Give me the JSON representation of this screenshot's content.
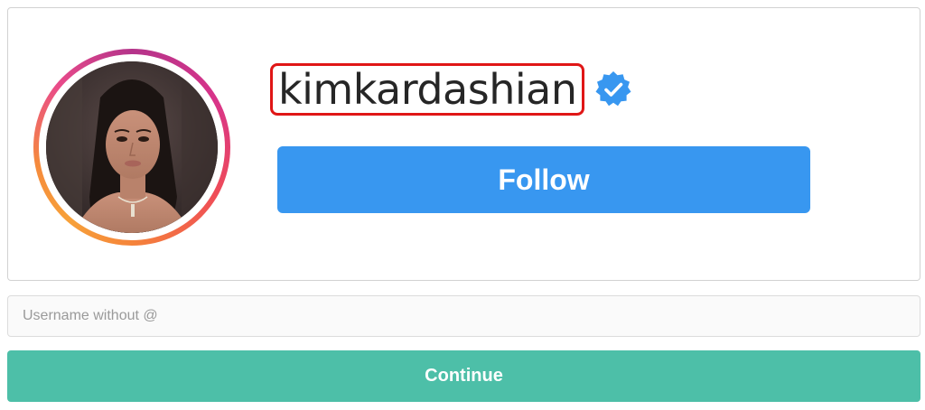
{
  "profile": {
    "username": "kimkardashian",
    "verified_icon": "verified-badge-icon",
    "follow_label": "Follow"
  },
  "form": {
    "username_placeholder": "Username without @",
    "username_value": "",
    "continue_label": "Continue"
  },
  "colors": {
    "follow_button": "#3897f0",
    "continue_button": "#4dbfa8",
    "highlight_box": "#e01616",
    "verified_badge": "#3897f0"
  }
}
